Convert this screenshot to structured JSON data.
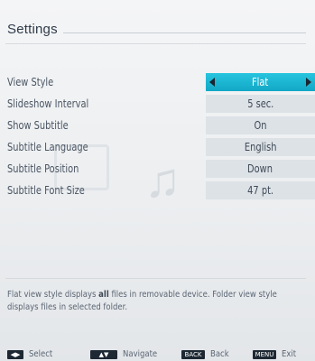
{
  "header": {
    "title": "Settings"
  },
  "rows": [
    {
      "label": "View Style",
      "value": "Flat"
    },
    {
      "label": "Slideshow Interval",
      "value": "5 sec."
    },
    {
      "label": "Show Subtitle",
      "value": "On"
    },
    {
      "label": "Subtitle Language",
      "value": "English"
    },
    {
      "label": "Subtitle Position",
      "value": "Down"
    },
    {
      "label": "Subtitle Font Size",
      "value": "47 pt."
    }
  ],
  "help": {
    "part1": "Flat view style displays ",
    "bold1": "all",
    "part2": " files in removable device. Folder view style displays files in selected folder."
  },
  "footer": {
    "select_key": "◀▶",
    "select_label": "Select",
    "navigate_key": "▲▼",
    "navigate_label": "Navigate",
    "back_key": "BACK",
    "back_label": "Back",
    "exit_key": "MENU",
    "exit_label": "Exit"
  },
  "colors": {
    "accent": "#1ab4d0",
    "background": "#eceef0"
  }
}
